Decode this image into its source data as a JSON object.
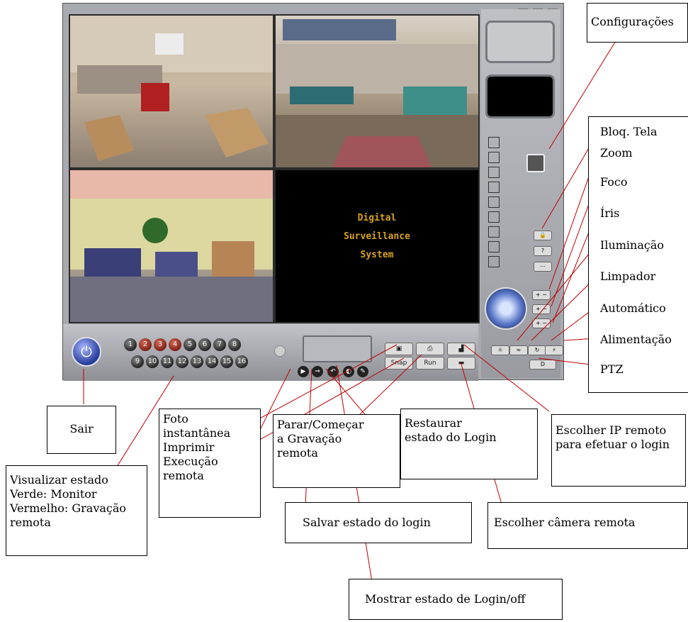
{
  "video": {
    "channel4_lines": [
      "Digital",
      "Surveillance",
      "System"
    ]
  },
  "controls": {
    "power_symbol": "⏻",
    "channels_row1": [
      "1",
      "2",
      "3",
      "4",
      "5",
      "6",
      "7",
      "8"
    ],
    "channels_row2": [
      "9",
      "10",
      "11",
      "12",
      "13",
      "14",
      "15",
      "16"
    ],
    "red_channels": [
      "2",
      "3",
      "4"
    ],
    "snap_label": "Snap",
    "run_label": "Run"
  },
  "annotations": {
    "configuracoes": "Configurações",
    "bloq_tela": "Bloq. Tela",
    "zoom": "Zoom",
    "foco": "Foco",
    "iris": "Íris",
    "iluminacao": "Iluminação",
    "limpador": "Limpador",
    "automatico": "Automático",
    "alimentacao": "Alimentação",
    "ptz": "PTZ",
    "sair": "Sair",
    "foto": [
      "Foto",
      "instantânea",
      "Imprimir",
      "Execução",
      "remota"
    ],
    "parar": [
      "Parar/Começar",
      "a Gravação",
      "remota"
    ],
    "restaurar": [
      "Restaurar",
      "estado do Login"
    ],
    "escolher_ip": [
      "Escolher IP remoto",
      "para efetuar o login"
    ],
    "visualizar": [
      "Visualizar estado",
      "Verde: Monitor",
      "Vermelho: Gravação",
      "remota"
    ],
    "salvar": "Salvar estado do login",
    "escolher_camera": "Escolher câmera remota",
    "mostrar": "Mostrar estado de Login/off"
  },
  "colors": {
    "leader_line": "#c00000",
    "screen_text": "#d7a21b",
    "power_button": "#233a9a"
  }
}
